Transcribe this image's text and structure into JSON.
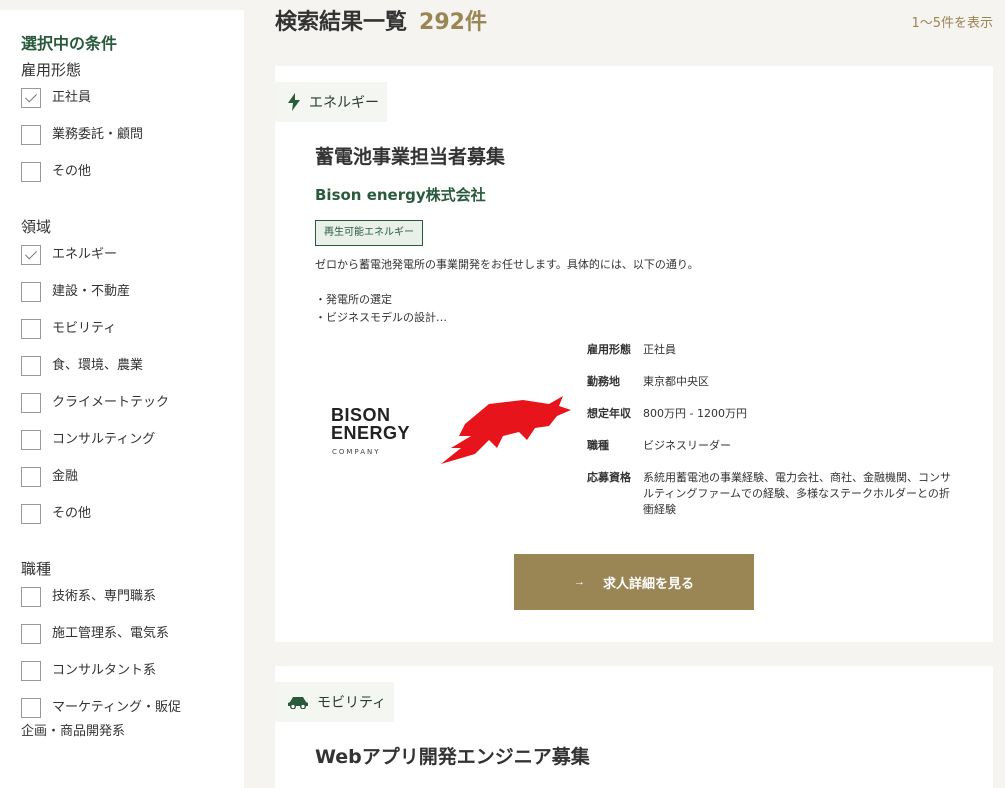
{
  "sidebar": {
    "title": "選択中の条件",
    "groups": [
      {
        "title": "雇用形態",
        "options": [
          {
            "label": "正社員",
            "checked": true
          },
          {
            "label": "業務委託・顧問",
            "checked": false
          },
          {
            "label": "その他",
            "checked": false
          }
        ]
      },
      {
        "title": "領域",
        "options": [
          {
            "label": "エネルギー",
            "checked": true
          },
          {
            "label": "建設・不動産",
            "checked": false
          },
          {
            "label": "モビリティ",
            "checked": false
          },
          {
            "label": "食、環境、農業",
            "checked": false
          },
          {
            "label": "クライメートテック",
            "checked": false
          },
          {
            "label": "コンサルティング",
            "checked": false
          },
          {
            "label": "金融",
            "checked": false
          },
          {
            "label": "その他",
            "checked": false
          }
        ]
      },
      {
        "title": "職種",
        "options": [
          {
            "label": "技術系、専門職系",
            "checked": false
          },
          {
            "label": "施工管理系、電気系",
            "checked": false
          },
          {
            "label": "コンサルタント系",
            "checked": false
          },
          {
            "label": "マーケティング・販促",
            "label2": "企画・商品開発系",
            "checked": false
          }
        ]
      }
    ]
  },
  "header": {
    "title": "検索結果一覧",
    "count": "292件",
    "range": "1〜5件を表示"
  },
  "jobs": [
    {
      "category": "エネルギー",
      "category_icon": "lightning-icon",
      "title": "蓄電池事業担当者募集",
      "company": "Bison energy株式会社",
      "badge": "再生可能エネルギー",
      "desc": [
        "ゼロから蓄電池発電所の事業開発をお任せします。具体的には、以下の通り。",
        "・発電所の選定",
        "・ビジネスモデルの設計…"
      ],
      "logo": {
        "line1": "BISON",
        "line2": "ENERGY",
        "line3": "COMPANY",
        "color": "#e8141c"
      },
      "info": [
        {
          "key": "雇用形態",
          "value": "正社員"
        },
        {
          "key": "勤務地",
          "value": "東京都中央区"
        },
        {
          "key": "想定年収",
          "value": "800万円 - 1200万円"
        },
        {
          "key": "職種",
          "value": "ビジネスリーダー"
        },
        {
          "key": "応募資格",
          "value": "系統用蓄電池の事業経験、電力会社、商社、金融機関、コンサルティングファームでの経験、多様なステークホルダーとの折衝経験"
        }
      ],
      "button": "求人詳細を見る"
    },
    {
      "category": "モビリティ",
      "category_icon": "car-icon",
      "title": "Webアプリ開発エンジニア募集"
    }
  ],
  "colors": {
    "accent_green": "#2a5a3c",
    "accent_gold": "#9a8554",
    "background": "#f5f4f0"
  }
}
